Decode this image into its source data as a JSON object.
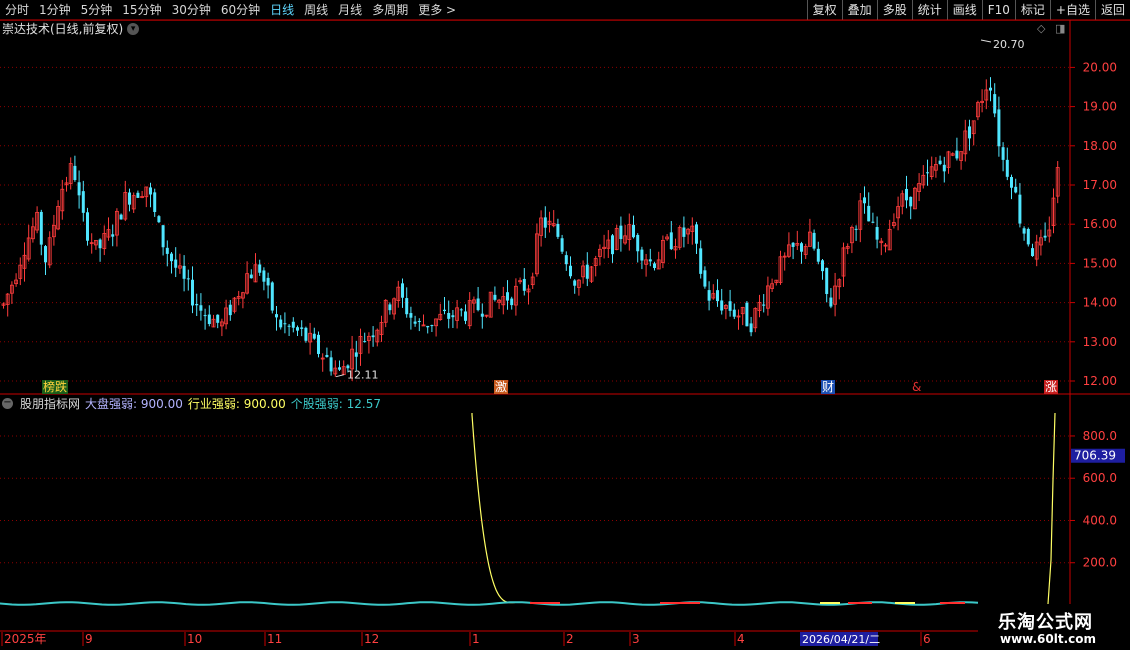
{
  "toolbar": {
    "periods": [
      "分时",
      "1分钟",
      "5分钟",
      "15分钟",
      "30分钟",
      "60分钟",
      "日线",
      "周线",
      "月线",
      "多周期",
      "更多 >"
    ],
    "active_period": "日线",
    "buttons": [
      "复权",
      "叠加",
      "多股",
      "统计",
      "画线",
      "F10",
      "标记",
      "+自选",
      "返回"
    ]
  },
  "main_chart": {
    "title": "崇达技术(日线,前复权)",
    "price_ticks": [
      "20.00",
      "19.00",
      "18.00",
      "17.00",
      "16.00",
      "15.00",
      "14.00",
      "13.00",
      "12.00"
    ],
    "high_label": "20.70",
    "low_label": "12.11",
    "markers": [
      {
        "text": "榜跌",
        "color": "#ffd23c",
        "bg": "#1c5e1c"
      },
      {
        "text": "激",
        "color": "#ffffff",
        "bg": "#c85a1e"
      },
      {
        "text": "财",
        "color": "#ffffff",
        "bg": "#1c50b4"
      },
      {
        "text": "&",
        "color": "#e03030",
        "bg": "#000000"
      },
      {
        "text": "涨",
        "color": "#ffffff",
        "bg": "#c81e1e"
      }
    ]
  },
  "indicator": {
    "name": "股朋指标网",
    "label1": "大盘强弱:",
    "value1": "900.00",
    "label2": "行业强弱:",
    "value2": "900.00",
    "label3": "个股强弱:",
    "value3": "12.57",
    "ticks": [
      "800.0",
      "600.0",
      "400.0",
      "200.0"
    ],
    "current_value": "706.39",
    "colors": {
      "market": "#b4b4ff",
      "industry": "#ffff64",
      "stock": "#3cc8c8"
    }
  },
  "date_axis": {
    "labels": [
      "2025年",
      "9",
      "10",
      "11",
      "12",
      "1",
      "2",
      "3",
      "4",
      "6"
    ],
    "highlight": "2026/04/21/二"
  },
  "watermark": {
    "line1": "乐淘公式网",
    "line2": "www.60lt.com"
  },
  "colors": {
    "up": "#ff3c3c",
    "down": "#50e6ff",
    "grid": "#8c0000",
    "axis": "#c80000"
  }
}
